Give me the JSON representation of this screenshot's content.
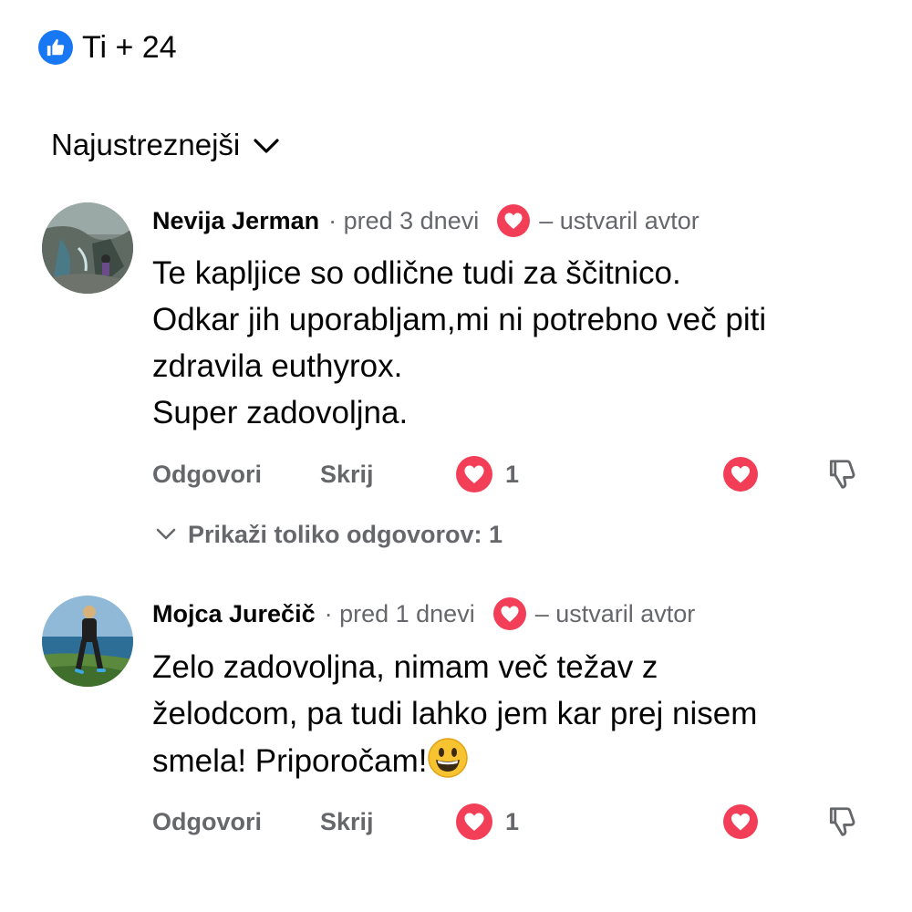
{
  "likes": {
    "summary_text": "Ti + 24",
    "icon": "thumbs-up-icon",
    "color": "#1877f2"
  },
  "sort": {
    "label": "Najustreznejši",
    "icon": "chevron-down-icon"
  },
  "colors": {
    "heart": "#f33e58",
    "secondary_text": "#65676b",
    "primary_text": "#050505"
  },
  "comments": [
    {
      "author": "Nevija Jerman",
      "time": "· pred 3 dnevi",
      "author_reaction": "heart-icon",
      "author_tag": "– ustvaril avtor",
      "lines": [
        "Te kapljice so odlične tudi za ščitnico.",
        "Odkar jih uporabljam,mi ni potrebno več piti",
        "zdravila euthyrox.",
        "Super zadovoljna."
      ],
      "actions": {
        "reply": "Odgovori",
        "hide": "Skrij",
        "reaction_count": "1"
      },
      "replies_toggle": "Prikaži toliko odgovorov: 1"
    },
    {
      "author": "Mojca Jurečič",
      "time": "· pred 1 dnevi",
      "author_reaction": "heart-icon",
      "author_tag": "– ustvaril avtor",
      "lines": [
        "Zelo zadovoljna, nimam več težav z",
        "želodcom, pa tudi lahko jem kar prej nisem",
        "smela! Priporočam!"
      ],
      "emoji": "grinning-face-emoji",
      "actions": {
        "reply": "Odgovori",
        "hide": "Skrij",
        "reaction_count": "1"
      }
    }
  ]
}
